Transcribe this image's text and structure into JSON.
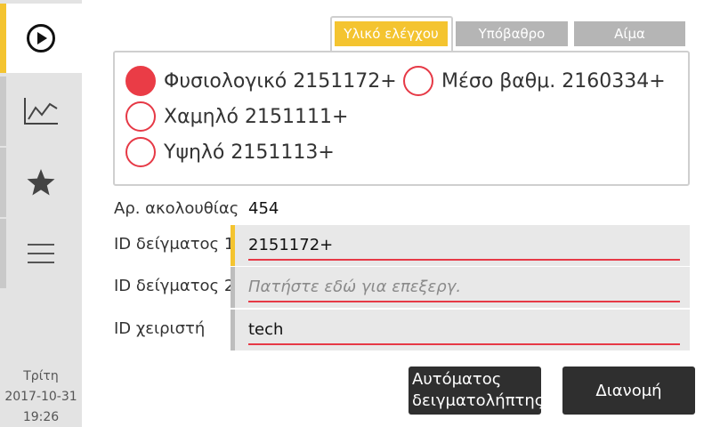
{
  "sidebar": {
    "items": [
      {
        "name": "run",
        "icon": "play-circle-icon",
        "active": true
      },
      {
        "name": "trends",
        "icon": "line-chart-icon",
        "active": false
      },
      {
        "name": "favorites",
        "icon": "star-icon",
        "active": false
      },
      {
        "name": "menu",
        "icon": "hamburger-menu-icon",
        "active": false
      }
    ],
    "datetime": {
      "day": "Τρίτη",
      "date": "2017-10-31",
      "time": "19:26"
    }
  },
  "tabs": [
    {
      "label": "Υλικό ελέγχου",
      "active": true
    },
    {
      "label": "Υπόβαθρο",
      "active": false
    },
    {
      "label": "Αίμα",
      "active": false
    }
  ],
  "controls": {
    "options": [
      {
        "label": "Φυσιολογικό 2151172+",
        "selected": true
      },
      {
        "label": "Μέσο βαθμ. 2160334+",
        "selected": false
      },
      {
        "label": "Χαμηλό 2151111+",
        "selected": false
      },
      {
        "label": "Υψηλό 2151113+",
        "selected": false
      }
    ]
  },
  "sequence": {
    "label": "Αρ. ακολουθίας",
    "value": "454"
  },
  "fields": [
    {
      "label": "ID δείγματος 1",
      "value": "2151172+",
      "placeholder": "",
      "focused": true
    },
    {
      "label": "ID δείγματος 2",
      "value": "",
      "placeholder": "Πατήστε εδώ για επεξεργ.",
      "focused": false
    },
    {
      "label": "ID χειριστή",
      "value": "tech",
      "placeholder": "",
      "focused": false
    }
  ],
  "buttons": {
    "autosampler_line1": "Αυτόματος",
    "autosampler_line2": "δειγματολήπτης",
    "dispense": "Διανομή"
  },
  "colors": {
    "accent": "#f4c430",
    "radio_red": "#ea3c46",
    "button_dark": "#2f2f2f",
    "tab_inactive": "#b5b5b5"
  }
}
